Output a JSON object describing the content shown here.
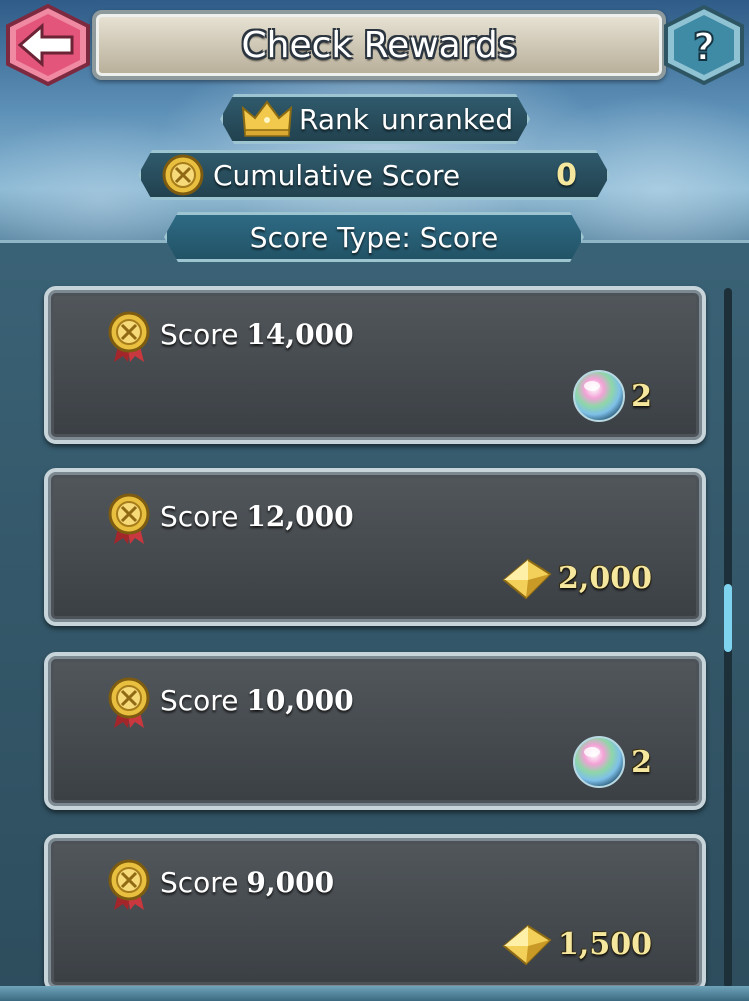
{
  "header": {
    "title": "Check Rewards",
    "back_icon": "arrow-left-icon",
    "help_icon": "question-mark-icon"
  },
  "rank": {
    "label": "Rank",
    "value": "unranked",
    "icon": "crown-icon"
  },
  "cumulative": {
    "label": "Cumulative Score",
    "value": "0",
    "icon": "medal-icon"
  },
  "score_type": {
    "label": "Score Type: Score"
  },
  "rewards": [
    {
      "score_label": "Score",
      "score_value": "14,000",
      "reward_icon": "orb-icon",
      "reward_amount": "2"
    },
    {
      "score_label": "Score",
      "score_value": "12,000",
      "reward_icon": "feather-crystal-icon",
      "reward_amount": "2,000"
    },
    {
      "score_label": "Score",
      "score_value": "10,000",
      "reward_icon": "orb-icon",
      "reward_amount": "2"
    },
    {
      "score_label": "Score",
      "score_value": "9,000",
      "reward_icon": "feather-crystal-icon",
      "reward_amount": "1,500"
    }
  ],
  "colors": {
    "accent_gold": "#f6e79e",
    "scroll_thumb": "#7ed4ef",
    "back_button": "#e65a7a"
  }
}
